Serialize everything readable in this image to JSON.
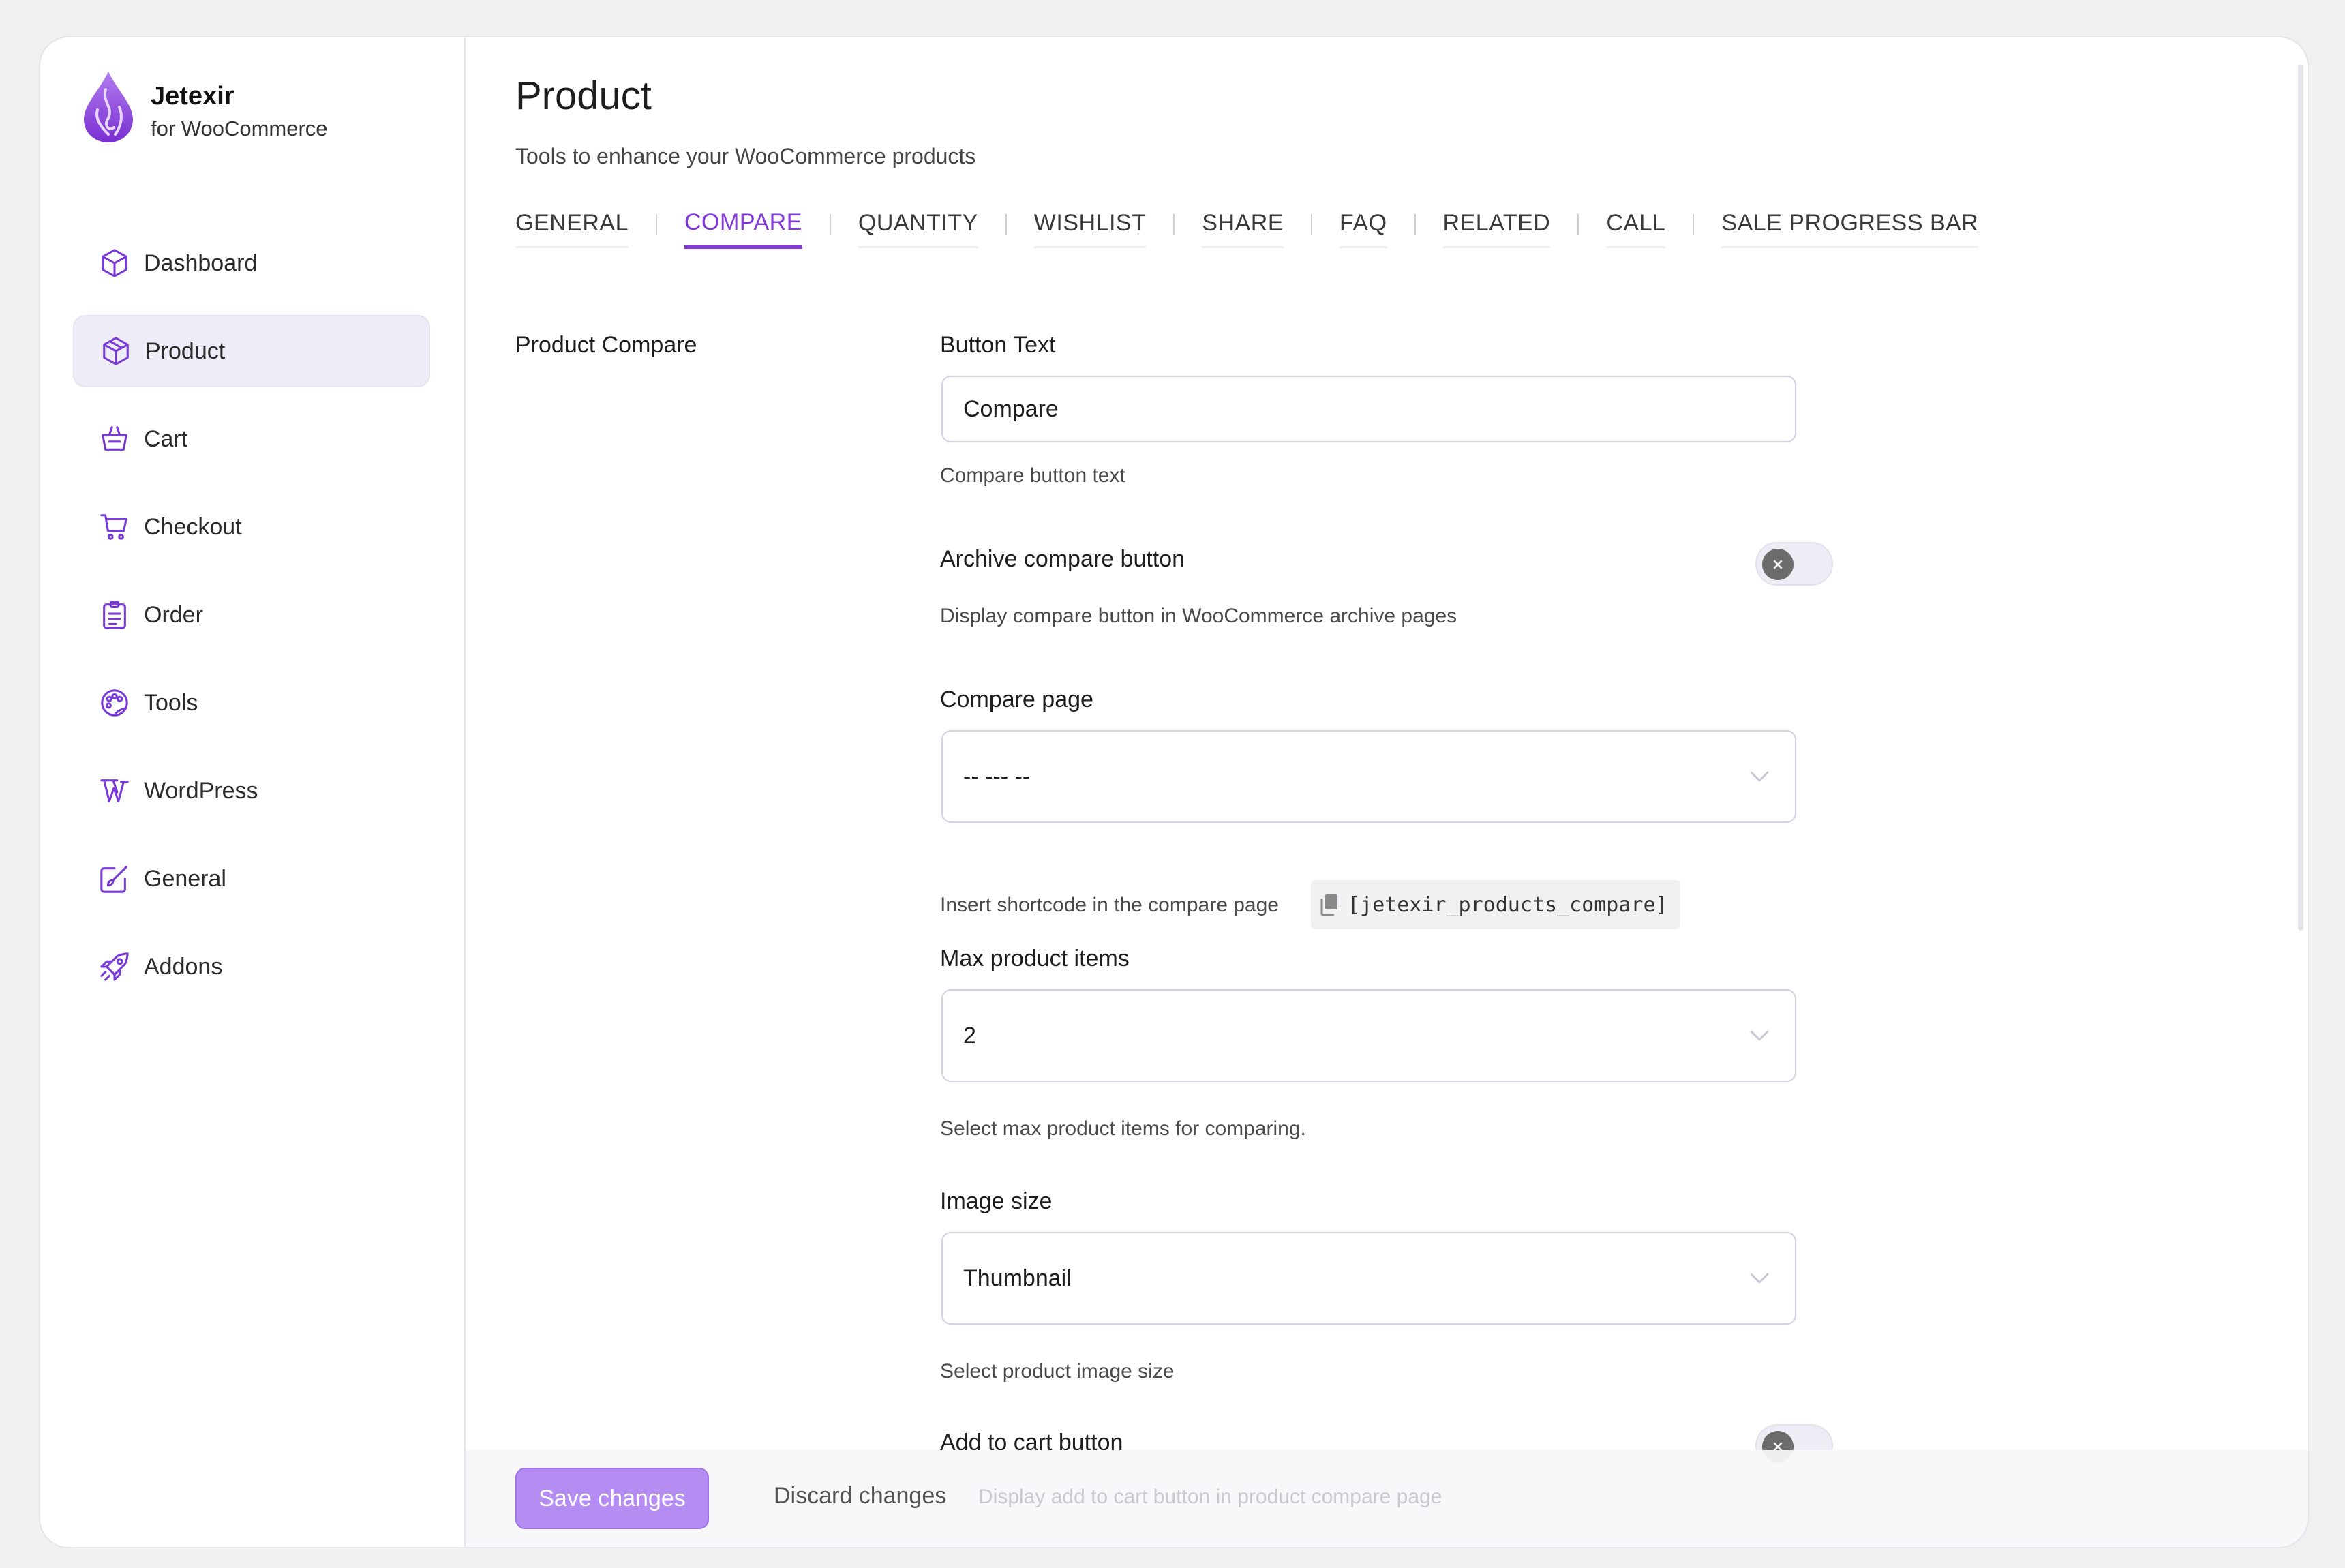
{
  "brand": {
    "title": "Jetexir",
    "subtitle": "for WooCommerce"
  },
  "colors": {
    "accent": "#8338d9",
    "save_button": "#b48cf2",
    "toggle_knob": "#6c6c6c"
  },
  "sidebar": {
    "items": [
      {
        "label": "Dashboard",
        "icon": "cube-icon",
        "active": false
      },
      {
        "label": "Product",
        "icon": "box-icon",
        "active": true
      },
      {
        "label": "Cart",
        "icon": "basket-icon",
        "active": false
      },
      {
        "label": "Checkout",
        "icon": "cart-icon",
        "active": false
      },
      {
        "label": "Order",
        "icon": "clipboard-list-icon",
        "active": false
      },
      {
        "label": "Tools",
        "icon": "palette-icon",
        "active": false
      },
      {
        "label": "WordPress",
        "icon": "wordpress-icon",
        "active": false
      },
      {
        "label": "General",
        "icon": "edit-brush-icon",
        "active": false
      },
      {
        "label": "Addons",
        "icon": "rocket-icon",
        "active": false
      }
    ]
  },
  "main": {
    "title": "Product",
    "subtitle": "Tools to enhance your WooCommerce products",
    "tabs": [
      {
        "label": "GENERAL",
        "active": false
      },
      {
        "label": "COMPARE",
        "active": true
      },
      {
        "label": "QUANTITY",
        "active": false
      },
      {
        "label": "WISHLIST",
        "active": false
      },
      {
        "label": "SHARE",
        "active": false
      },
      {
        "label": "FAQ",
        "active": false
      },
      {
        "label": "RELATED",
        "active": false
      },
      {
        "label": "CALL",
        "active": false
      },
      {
        "label": "SALE PROGRESS BAR",
        "active": false
      }
    ],
    "section_label": "Product Compare"
  },
  "form": {
    "button_text": {
      "label": "Button Text",
      "value": "Compare",
      "help": "Compare button text"
    },
    "archive_compare": {
      "label": "Archive compare button",
      "enabled": false,
      "help": "Display compare button in WooCommerce archive pages"
    },
    "compare_page": {
      "label": "Compare page",
      "value": "-- --- --",
      "help": "Insert shortcode in the compare page",
      "shortcode": "[jetexir_products_compare]"
    },
    "max_items": {
      "label": "Max product items",
      "value": "2",
      "help": "Select max product items for comparing."
    },
    "image_size": {
      "label": "Image size",
      "value": "Thumbnail",
      "help": "Select product image size"
    },
    "add_to_cart": {
      "label": "Add to cart button",
      "enabled": false,
      "help": "Display add to cart button in product compare page"
    }
  },
  "footer": {
    "save_label": "Save changes",
    "discard_label": "Discard changes"
  }
}
